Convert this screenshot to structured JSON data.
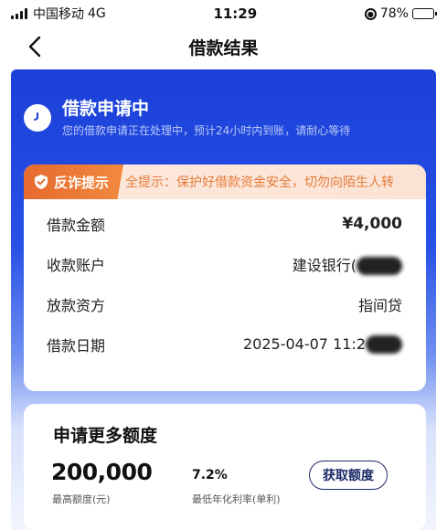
{
  "status_bar": {
    "carrier": "中国移动",
    "network": "4G",
    "time": "11:29",
    "battery": "78%",
    "battery_level": 0.78
  },
  "nav": {
    "title": "借款结果"
  },
  "application_status": {
    "title": "借款申请中",
    "subtitle": "您的借款申请正在处理中，预计24小时内到账，请耐心等待"
  },
  "anti_fraud": {
    "tag": "反诈提示",
    "text": "全提示：保护好借款资金安全，切勿向陌生人转"
  },
  "details": [
    {
      "label": "借款金额",
      "value": "¥4,000"
    },
    {
      "label": "收款账户",
      "value": "建设银行("
    },
    {
      "label": "放款资方",
      "value": "指间贷"
    },
    {
      "label": "借款日期",
      "value": "2025-04-07 11:2"
    }
  ],
  "quota": {
    "title": "申请更多额度",
    "max_amount": "200,000",
    "max_label": "最高额度(元)",
    "rate": "7.2%",
    "rate_label": "最低年化利率(单利)",
    "button": "获取额度"
  },
  "colors": {
    "primary_blue": "#1b40d8",
    "warning_orange": "#e66a2e",
    "battery_green": "#35c24a"
  }
}
